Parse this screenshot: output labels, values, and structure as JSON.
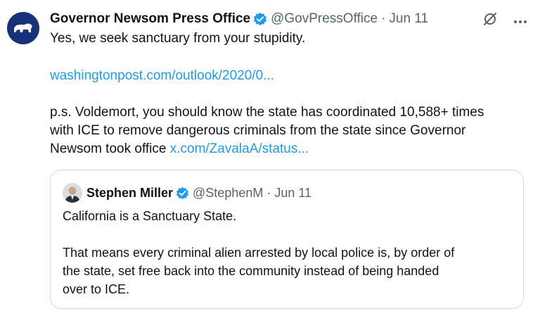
{
  "tweet": {
    "author_name": "Governor Newsom Press Office",
    "handle": "@GovPressOffice",
    "separator": "·",
    "date": "Jun 11",
    "line1": "Yes, we seek sanctuary from your stupidity.",
    "link1": "washingtonpost.com/outlook/2020/0...",
    "ps_line1": "p.s. Voldemort, you should know the state has coordinated 10,588+ times",
    "ps_line2": "with ICE to remove dangerous criminals from the state since Governor",
    "ps_line3_text": "Newsom took office",
    "link2": "x.com/ZavalaA/status..."
  },
  "quoted_tweet": {
    "author_name": "Stephen Miller",
    "handle": "@StephenM",
    "separator": "·",
    "date": "Jun 11",
    "line1": "California is a Sanctuary State.",
    "para2_line1": "That means every criminal alien arrested by local police is, by order of",
    "para2_line2": "the state, set free back into the community instead of being handed",
    "para2_line3": "over to ICE."
  },
  "colors": {
    "link": "#1d9bf0",
    "verified": "#1d9bf0",
    "muted": "#536471",
    "avatar_bg": "#16337a"
  },
  "icons": [
    "bear-logo-icon",
    "verified-badge-icon",
    "grok-icon",
    "more-options-icon"
  ]
}
